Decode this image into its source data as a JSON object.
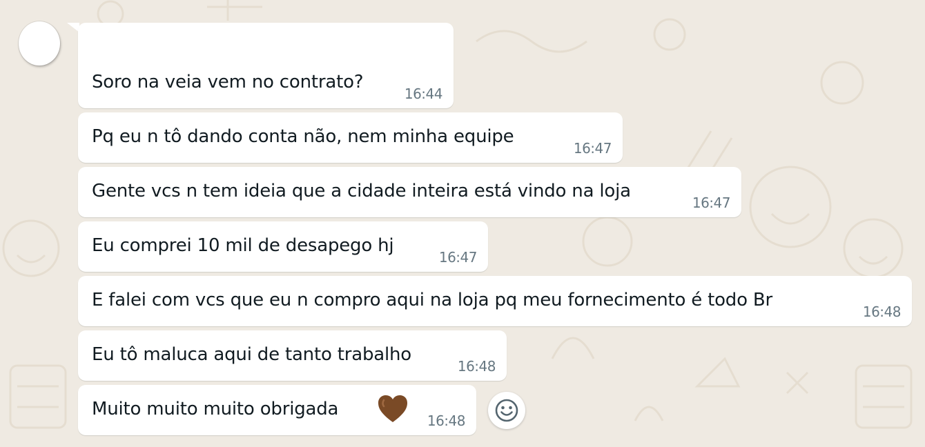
{
  "chat": {
    "messages": [
      {
        "text": "Soro na veia vem no contrato?",
        "time": "16:44"
      },
      {
        "text": "Pq eu n tô dando conta não, nem minha equipe",
        "time": "16:47"
      },
      {
        "text": "Gente vcs n tem ideia que a cidade inteira está vindo na loja",
        "time": "16:47"
      },
      {
        "text": "Eu comprei 10 mil de desapego hj",
        "time": "16:47"
      },
      {
        "text": "E falei com vcs que eu n compro aqui na loja pq meu fornecimento é  todo Br",
        "time": "16:48"
      },
      {
        "text": "Eu tô maluca aqui de tanto trabalho",
        "time": "16:48"
      },
      {
        "text": "Muito muito muito obrigada",
        "emoji": "brown-heart",
        "time": "16:48"
      }
    ],
    "react_button_icon": "smiley-icon"
  },
  "colors": {
    "background": "#efeae2",
    "bubble": "#ffffff",
    "text": "#111b21",
    "timestamp": "#667781",
    "heart": "#7a4a26"
  }
}
